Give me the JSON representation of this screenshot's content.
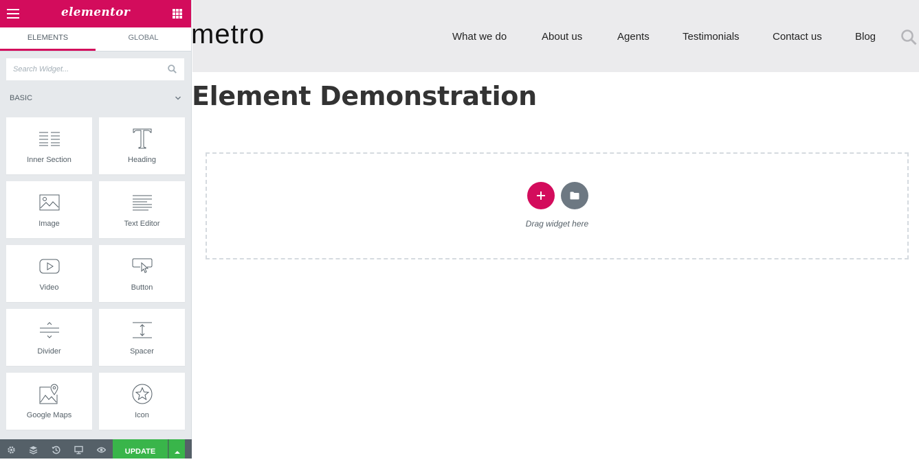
{
  "sidebar": {
    "header": {
      "logo": "elementor"
    },
    "tabs": [
      {
        "label": "ELEMENTS",
        "active": true
      },
      {
        "label": "GLOBAL",
        "active": false
      }
    ],
    "search": {
      "placeholder": "Search Widget..."
    },
    "section": {
      "title": "BASIC"
    },
    "widgets": [
      {
        "label": "Inner Section",
        "icon": "inner-section-icon"
      },
      {
        "label": "Heading",
        "icon": "heading-icon"
      },
      {
        "label": "Image",
        "icon": "image-icon"
      },
      {
        "label": "Text Editor",
        "icon": "text-editor-icon"
      },
      {
        "label": "Video",
        "icon": "video-icon"
      },
      {
        "label": "Button",
        "icon": "button-icon"
      },
      {
        "label": "Divider",
        "icon": "divider-icon"
      },
      {
        "label": "Spacer",
        "icon": "spacer-icon"
      },
      {
        "label": "Google Maps",
        "icon": "google-maps-icon"
      },
      {
        "label": "Icon",
        "icon": "star-icon"
      }
    ],
    "footer": {
      "update_label": "UPDATE",
      "icons": [
        "settings-icon",
        "navigator-icon",
        "history-icon",
        "responsive-icon",
        "preview-icon"
      ]
    }
  },
  "preview": {
    "brand": "metro",
    "nav": [
      "What we do",
      "About us",
      "Agents",
      "Testimonials",
      "Contact us",
      "Blog"
    ],
    "page_title": "Element Demonstration",
    "drop_area": {
      "text": "Drag widget here"
    }
  },
  "colors": {
    "accent": "#d30c5c",
    "update_green": "#39b54a",
    "panel_bg": "#e6e9ec",
    "footer_bg": "#556068",
    "site_header_bg": "#ebebed"
  }
}
